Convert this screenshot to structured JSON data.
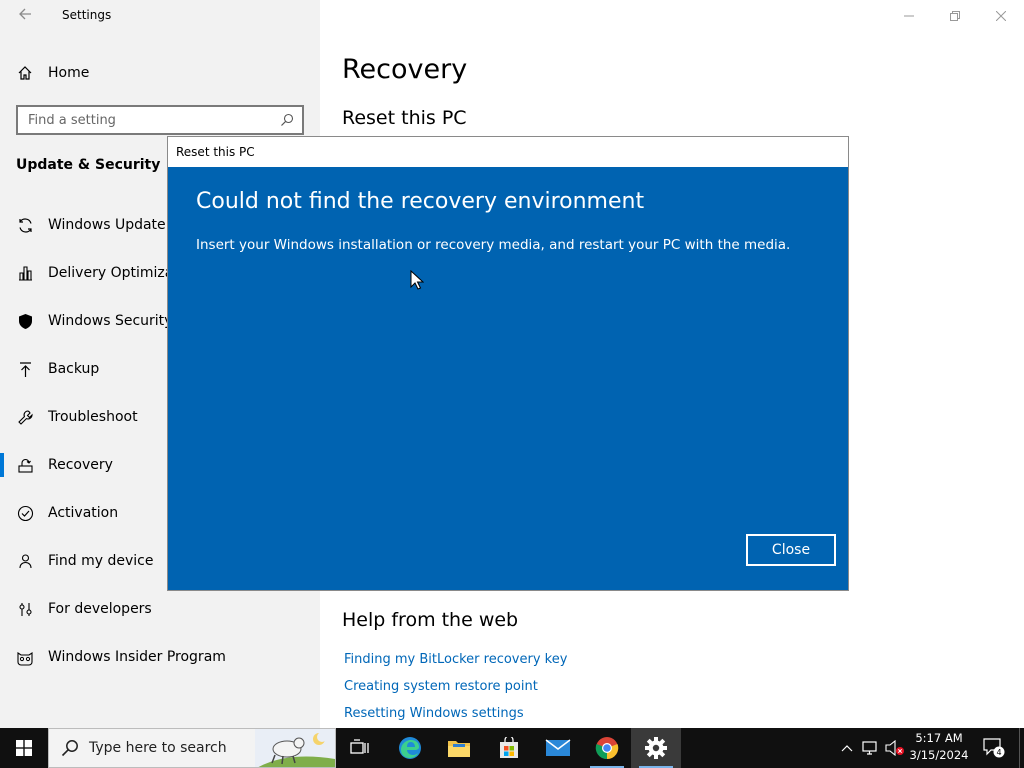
{
  "app": {
    "title": "Settings",
    "back_icon": "back-arrow-icon"
  },
  "sidebar": {
    "home_label": "Home",
    "search_placeholder": "Find a setting",
    "section_title": "Update & Security",
    "items": [
      {
        "label": "Windows Update",
        "icon": "sync-icon"
      },
      {
        "label": "Delivery Optimization",
        "icon": "delivery-optimization-icon"
      },
      {
        "label": "Windows Security",
        "icon": "shield-icon"
      },
      {
        "label": "Backup",
        "icon": "backup-arrow-icon"
      },
      {
        "label": "Troubleshoot",
        "icon": "wrench-icon"
      },
      {
        "label": "Recovery",
        "icon": "recovery-icon",
        "selected": true
      },
      {
        "label": "Activation",
        "icon": "checkmark-circle-icon"
      },
      {
        "label": "Find my device",
        "icon": "person-pin-icon"
      },
      {
        "label": "For developers",
        "icon": "developer-tools-icon"
      },
      {
        "label": "Windows Insider Program",
        "icon": "insider-cat-icon"
      }
    ]
  },
  "main": {
    "page_title": "Recovery",
    "reset_heading": "Reset this PC",
    "help_heading": "Help from the web",
    "help_links": [
      "Finding my BitLocker recovery key",
      "Creating system restore point",
      "Resetting Windows settings"
    ]
  },
  "dialog": {
    "title": "Reset this PC",
    "heading": "Could not find the recovery environment",
    "message": "Insert your Windows installation or recovery media, and restart your PC with the media.",
    "close_label": "Close",
    "background_color": "#0063b1"
  },
  "taskbar": {
    "search_placeholder": "Type here to search",
    "apps": [
      {
        "name": "task-view",
        "icon": "task-view-icon"
      },
      {
        "name": "edge",
        "icon": "edge-icon"
      },
      {
        "name": "file-explorer",
        "icon": "folder-icon"
      },
      {
        "name": "microsoft-store",
        "icon": "store-icon"
      },
      {
        "name": "mail",
        "icon": "mail-icon"
      },
      {
        "name": "chrome",
        "icon": "chrome-icon"
      },
      {
        "name": "settings",
        "icon": "gear-icon",
        "active": true
      }
    ],
    "time": "5:17 AM",
    "date": "3/15/2024",
    "notification_count": "4"
  },
  "colors": {
    "accent": "#0078d7",
    "link": "#0067b8",
    "taskbar": "#101010"
  }
}
